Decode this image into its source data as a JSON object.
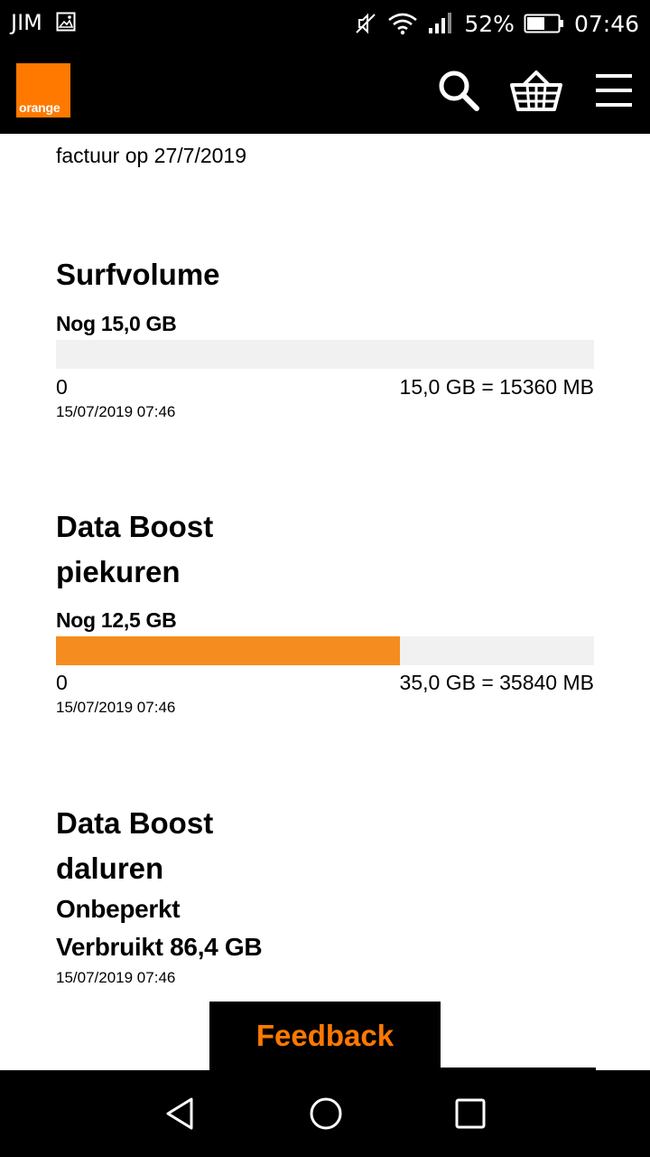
{
  "status_bar": {
    "carrier": "JIM",
    "battery": "52%",
    "time": "07:46"
  },
  "header": {
    "logo_text": "orange",
    "brand_color": "#ff7900",
    "icons": [
      "search-icon",
      "basket-icon",
      "menu-icon"
    ]
  },
  "intro": {
    "partial_line": "factuur op 27/7/2019"
  },
  "sections": [
    {
      "title": "Surfvolume",
      "remaining": "Nog 15,0 GB",
      "progress_fraction": 0.0,
      "scale_min": "0",
      "scale_max": "15,0 GB = 15360 MB",
      "timestamp": "15/07/2019 07:46"
    },
    {
      "title_line1": "Data Boost",
      "title_line2": "piekuren",
      "remaining": "Nog 12,5 GB",
      "progress_fraction": 0.64,
      "progress_color": "#f58c20",
      "scale_min": "0",
      "scale_max": "35,0 GB = 35840 MB",
      "timestamp": "15/07/2019 07:46"
    },
    {
      "title_line1": "Data Boost",
      "title_line2": "daluren",
      "status": "Onbeperkt",
      "used": "Verbruikt 86,4 GB",
      "timestamp": "15/07/2019 07:46"
    }
  ],
  "feedback": {
    "label": "Feedback",
    "color": "#ff7900"
  },
  "nav": [
    "back-icon",
    "home-icon",
    "recents-icon"
  ]
}
